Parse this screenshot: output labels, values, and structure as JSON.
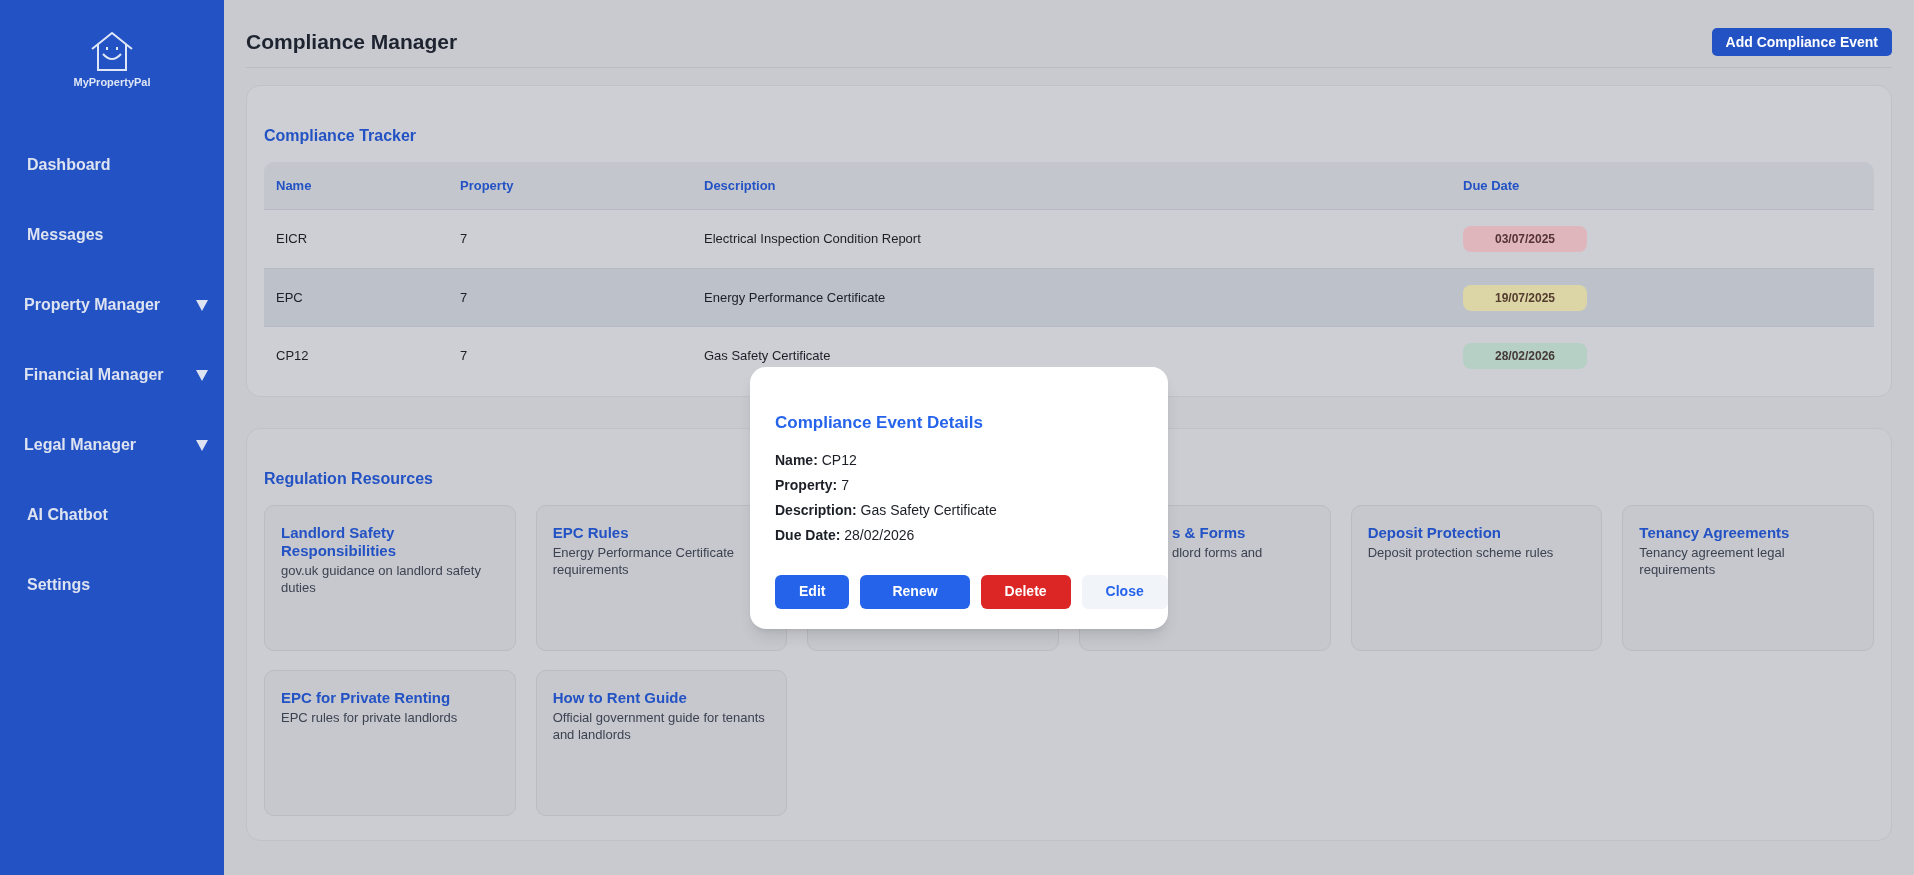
{
  "sidebar": {
    "logo": "MyPropertyPal",
    "items": [
      {
        "label": "Dashboard",
        "dropdown": false
      },
      {
        "label": "Messages",
        "dropdown": false
      },
      {
        "label": "Property Manager",
        "dropdown": true
      },
      {
        "label": "Financial Manager",
        "dropdown": true
      },
      {
        "label": "Legal Manager",
        "dropdown": true
      },
      {
        "label": "AI Chatbot",
        "dropdown": false
      },
      {
        "label": "Settings",
        "dropdown": false
      }
    ]
  },
  "header": {
    "title": "Compliance Manager",
    "button": "Add Compliance Event"
  },
  "tracker": {
    "title": "Compliance Tracker",
    "columns": [
      "Name",
      "Property",
      "Description",
      "Due Date"
    ],
    "rows": [
      {
        "name": "EICR",
        "property": "7",
        "description": "Electrical Inspection Condition Report",
        "due_date": "03/07/2025",
        "color": "#dfb6bc",
        "selected": false
      },
      {
        "name": "EPC",
        "property": "7",
        "description": "Energy Performance Certificate",
        "due_date": "19/07/2025",
        "color": "#dcd6a6",
        "selected": true
      },
      {
        "name": "CP12",
        "property": "7",
        "description": "Gas Safety Certificate",
        "due_date": "28/02/2026",
        "color": "#b6d0c6",
        "selected": false
      }
    ]
  },
  "resources": {
    "title": "Regulation Resources",
    "cards": [
      {
        "kind": "resource",
        "title": "Landlord Safety Responsibilities",
        "description": "gov.uk guidance on landlord safety duties"
      },
      {
        "kind": "resource",
        "title": "EPC Rules",
        "description": "Energy Performance Certificate requirements"
      },
      {
        "kind": "covered"
      },
      {
        "kind": "clipped",
        "title": "s & Forms",
        "description": "dlord forms and"
      },
      {
        "kind": "resource",
        "title": "Deposit Protection",
        "description": "Deposit protection scheme rules"
      },
      {
        "kind": "resource",
        "title": "Tenancy Agreements",
        "description": "Tenancy agreement legal requirements"
      },
      {
        "kind": "resource",
        "title": "EPC for Private Renting",
        "description": "EPC rules for private landlords"
      },
      {
        "kind": "resource",
        "title": "How to Rent Guide",
        "description": "Official government guide for tenants and landlords"
      }
    ]
  },
  "modal": {
    "title": "Compliance Event Details",
    "fields": [
      {
        "label": "Name:",
        "value": "CP12"
      },
      {
        "label": "Property:",
        "value": "7"
      },
      {
        "label": "Description:",
        "value": "Gas Safety Certificate"
      },
      {
        "label": "Due Date:",
        "value": "28/02/2026"
      }
    ],
    "buttons": [
      {
        "label": "Edit",
        "kind": "primary"
      },
      {
        "label": "Renew",
        "kind": "primary"
      },
      {
        "label": "Delete",
        "kind": "danger"
      },
      {
        "label": "Close",
        "kind": "secondary"
      }
    ]
  }
}
